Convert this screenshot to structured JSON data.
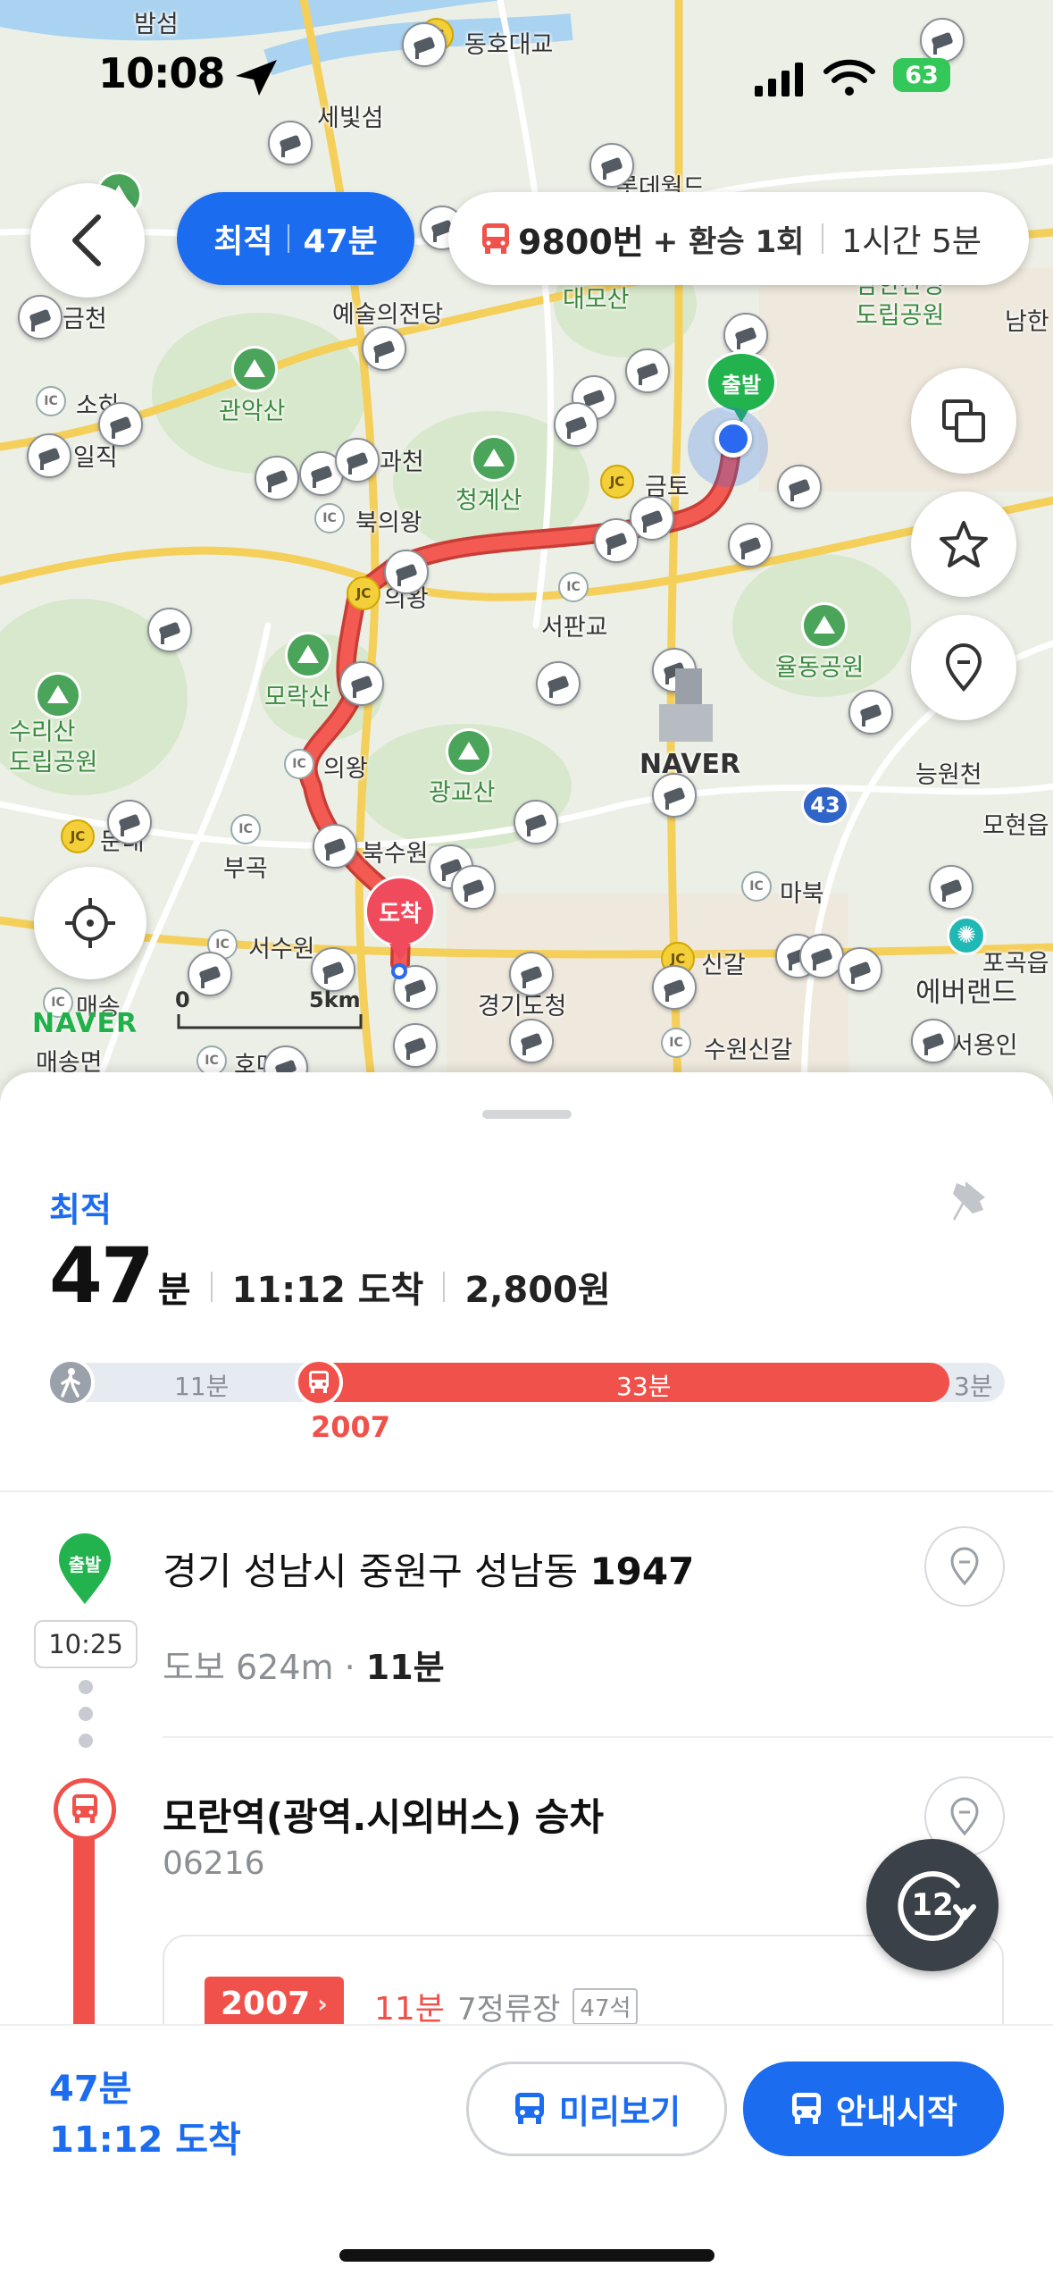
{
  "status_bar": {
    "time": "10:08",
    "battery": "63"
  },
  "top_bar": {
    "mode_label": "최적",
    "mode_time": "47분",
    "route_bus": "9800번",
    "route_transfer": "+ 환승 1회",
    "route_duration": "1시간 5분"
  },
  "map": {
    "labels": {
      "bamseom": "밤섬",
      "donghodaegyo": "동호대교",
      "sebitseom": "세빛섬",
      "lotteworld": "롯데월드",
      "geumcheon": "금천",
      "art_center": "예술의전당",
      "daemosan": "대모산",
      "namhansanseong": "남한산성\n도립공원",
      "namhan": "남한",
      "sohwa": "소하",
      "gwanaksan": "관악산",
      "iljik": "일직",
      "gwacheon": "과천",
      "cheonggyesan": "청계산",
      "bukuiwang": "북의왕",
      "geumto": "금토",
      "uiwang_jc": "의왕",
      "seopangyo": "서판교",
      "yuldong": "율동공원",
      "moraksan": "모락산",
      "surisan": "수리산\n도립공원",
      "uiwang_ic": "의왕",
      "naver_hq": "NAVER",
      "neungwoncheon": "능원천",
      "gwanggyosan": "광교산",
      "moheon": "모현읍",
      "dunpo": "둔대",
      "bugok": "부곡",
      "buksuwon": "북수원",
      "mabuk": "마북",
      "seosuwon": "서수원",
      "sinnam": "신갈",
      "everland": "에버랜드",
      "pogok": "포곡읍",
      "maesong_ic": "매송",
      "maesong": "매송면",
      "gyeonggi_do": "경기도청",
      "suwon_singal": "수원신갈",
      "seoyongin": "서용인",
      "homae": "호매",
      "route_43": "43",
      "start_pin": "출발",
      "end_pin": "도착",
      "scale_zero": "0",
      "scale_km": "5km",
      "naver_logo": "NAVER"
    }
  },
  "summary": {
    "category": "최적",
    "minutes": "47",
    "minutes_unit": "분",
    "arrival": "11:12 도착",
    "fare": "2,800원",
    "bar": {
      "walk1": "11분",
      "bus": "33분",
      "walk2": "3분",
      "bus_number": "2007"
    }
  },
  "steps": {
    "start": {
      "pin": "출발",
      "time": "10:25",
      "address_prefix": "경기 성남시 중원구 성남동 ",
      "address_number": "1947",
      "walk_prefix": "도보 624m · ",
      "walk_time": "11분"
    },
    "board": {
      "stop_name": "모란역(광역.시외버스) 승차",
      "stop_id": "06216",
      "bus_number": "2007",
      "bus_eta": "11분",
      "bus_stops": "7정류장",
      "bus_seats": "47석",
      "refresh": "12"
    }
  },
  "footer": {
    "minutes": "47분",
    "arrival": "11:12 도착",
    "preview_label": "미리보기",
    "start_label": "안내시작"
  }
}
